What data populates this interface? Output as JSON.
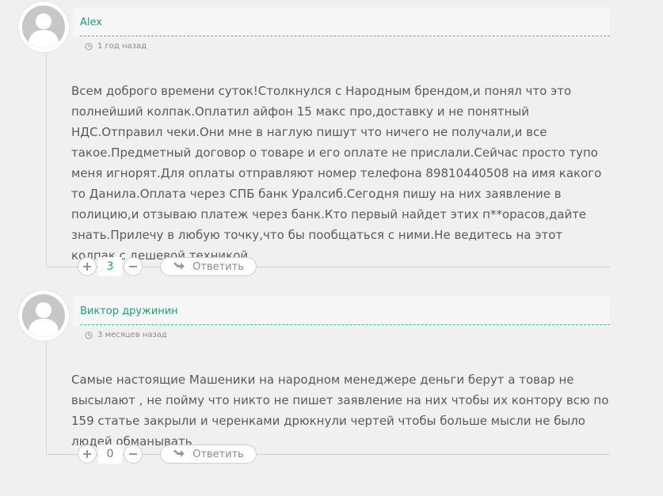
{
  "comments": [
    {
      "author": "Alex",
      "time": "1 год назад",
      "text": "Всем доброго времени суток!Столкнулся с Народным брендом,и понял что это полнейший колпак.Оплатил айфон 15 макс про,доставку и не понятный НДС.Отправил чеки.Они мне в наглую пишут что ничего не получали,и все такое.Предметный договор о товаре и его оплате не прислали.Сейчас просто тупо меня игнорят.Для оплаты отправляют номер телефона 89810440508 на имя какого то Данила.Оплата через СПБ банк Уралсиб.Сегодня пишу на них заявление в полицию,и отзываю платеж через банк.Кто первый найдет этих п**орасов,дайте знать.Прилечу в любую точку,что бы пообщаться с ними.Не ведитесь на этот колпак,с дешевой техникой.",
      "votes": "3",
      "reply_label": "Ответить"
    },
    {
      "author": "Виктор дружинин",
      "time": "3 месяцев назад",
      "text": "Самые настоящие Машеники на народном менеджере деньги берут а товар не высылают , не пойму что никто не пишет заявление на них чтобы их контору всю по 159 статье закрыли и черенками дрюкнули чертей чтобы больше мысли не было людей обманывать",
      "votes": "0",
      "reply_label": "Ответить"
    }
  ],
  "colors": {
    "accent": "#1ea07a",
    "dashed": "#2fbf87",
    "background": "#f0f0f0",
    "text": "#5a5a5a"
  },
  "icons": [
    "user-avatar-icon",
    "clock-icon",
    "plus-icon",
    "minus-icon",
    "reply-arrow-icon"
  ]
}
